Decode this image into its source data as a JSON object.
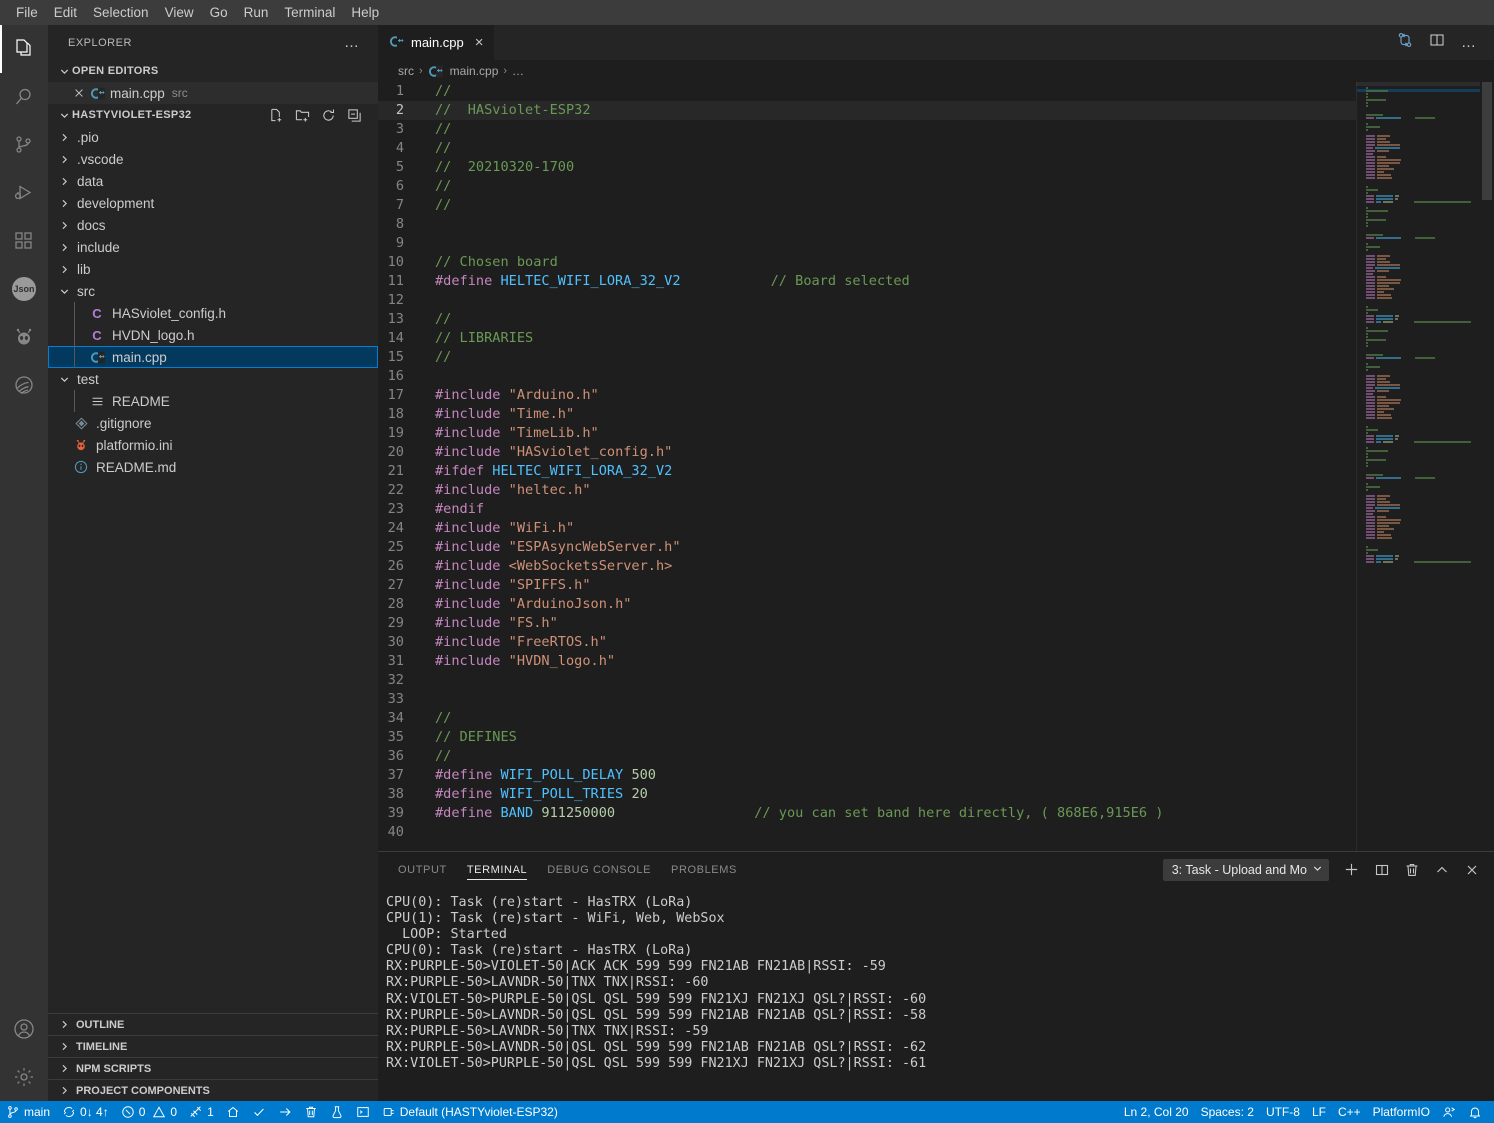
{
  "menubar": {
    "items": [
      "File",
      "Edit",
      "Selection",
      "View",
      "Go",
      "Run",
      "Terminal",
      "Help"
    ]
  },
  "activitybar": {
    "icons": [
      {
        "name": "explorer-icon",
        "active": true
      },
      {
        "name": "search-icon",
        "active": false
      },
      {
        "name": "source-control-icon",
        "active": false
      },
      {
        "name": "run-and-debug-icon",
        "active": false
      },
      {
        "name": "extensions-icon",
        "active": false
      },
      {
        "name": "json-icon",
        "label": "Json",
        "active": false
      },
      {
        "name": "platformio-alien-icon",
        "active": false
      },
      {
        "name": "remote-explorer-icon",
        "active": false
      }
    ],
    "bottom": [
      {
        "name": "accounts-icon"
      },
      {
        "name": "settings-gear-icon"
      }
    ]
  },
  "sidebar": {
    "title": "EXPLORER",
    "more_actions": "…",
    "open_editors": {
      "label": "OPEN EDITORS",
      "items": [
        {
          "name": "main.cpp",
          "folder": "src",
          "icon": "cpp-file-icon"
        }
      ]
    },
    "project": {
      "label": "HASTYVIOLET-ESP32",
      "actions": [
        "new-file-icon",
        "new-folder-icon",
        "refresh-icon",
        "collapse-all-icon"
      ],
      "tree": [
        {
          "label": ".pio",
          "type": "folder",
          "expanded": false,
          "indent": 1
        },
        {
          "label": ".vscode",
          "type": "folder",
          "expanded": false,
          "indent": 1
        },
        {
          "label": "data",
          "type": "folder",
          "expanded": false,
          "indent": 1
        },
        {
          "label": "development",
          "type": "folder",
          "expanded": false,
          "indent": 1
        },
        {
          "label": "docs",
          "type": "folder",
          "expanded": false,
          "indent": 1
        },
        {
          "label": "include",
          "type": "folder",
          "expanded": false,
          "indent": 1
        },
        {
          "label": "lib",
          "type": "folder",
          "expanded": false,
          "indent": 1
        },
        {
          "label": "src",
          "type": "folder",
          "expanded": true,
          "indent": 1
        },
        {
          "label": "HASviolet_config.h",
          "type": "header-file",
          "indent": 2
        },
        {
          "label": "HVDN_logo.h",
          "type": "header-file",
          "indent": 2
        },
        {
          "label": "main.cpp",
          "type": "cpp-file",
          "indent": 2,
          "selected": true
        },
        {
          "label": "test",
          "type": "folder",
          "expanded": true,
          "indent": 1
        },
        {
          "label": "README",
          "type": "readme-file",
          "indent": 2
        },
        {
          "label": ".gitignore",
          "type": "git-file",
          "indent": 1
        },
        {
          "label": "platformio.ini",
          "type": "platformio-file",
          "indent": 1
        },
        {
          "label": "README.md",
          "type": "markdown-file",
          "indent": 1
        }
      ]
    },
    "collapsed_sections": [
      "OUTLINE",
      "TIMELINE",
      "NPM SCRIPTS",
      "PROJECT COMPONENTS"
    ]
  },
  "editor": {
    "tabs": [
      {
        "label": "main.cpp",
        "icon": "cpp-file-icon",
        "active": true,
        "close": "×"
      }
    ],
    "tab_actions": [
      "split-editor-vertical-icon",
      "more-actions-icon"
    ],
    "breadcrumb": [
      "src",
      "main.cpp",
      "…"
    ],
    "breadcrumb_separator": "›",
    "lines": [
      {
        "n": 1,
        "tokens": [
          {
            "t": "//",
            "c": "c-comment"
          }
        ]
      },
      {
        "n": 2,
        "current": true,
        "tokens": [
          {
            "t": "//  HASviolet-ESP32",
            "c": "c-comment"
          }
        ]
      },
      {
        "n": 3,
        "tokens": [
          {
            "t": "//",
            "c": "c-comment"
          }
        ]
      },
      {
        "n": 4,
        "tokens": [
          {
            "t": "//",
            "c": "c-comment"
          }
        ]
      },
      {
        "n": 5,
        "tokens": [
          {
            "t": "//  20210320-1700",
            "c": "c-comment"
          }
        ]
      },
      {
        "n": 6,
        "tokens": [
          {
            "t": "//",
            "c": "c-comment"
          }
        ]
      },
      {
        "n": 7,
        "tokens": [
          {
            "t": "//",
            "c": "c-comment"
          }
        ]
      },
      {
        "n": 8,
        "tokens": []
      },
      {
        "n": 9,
        "tokens": []
      },
      {
        "n": 10,
        "tokens": [
          {
            "t": "// Chosen board",
            "c": "c-comment"
          }
        ]
      },
      {
        "n": 11,
        "tokens": [
          {
            "t": "#define ",
            "c": "c-pre"
          },
          {
            "t": "HELTEC_WIFI_LORA_32_V2",
            "c": "c-macro"
          },
          {
            "t": "           ",
            "c": "c-plain"
          },
          {
            "t": "// Board selected",
            "c": "c-comment"
          }
        ]
      },
      {
        "n": 12,
        "tokens": []
      },
      {
        "n": 13,
        "tokens": [
          {
            "t": "//",
            "c": "c-comment"
          }
        ]
      },
      {
        "n": 14,
        "tokens": [
          {
            "t": "// LIBRARIES",
            "c": "c-comment"
          }
        ]
      },
      {
        "n": 15,
        "tokens": [
          {
            "t": "//",
            "c": "c-comment"
          }
        ]
      },
      {
        "n": 16,
        "tokens": []
      },
      {
        "n": 17,
        "tokens": [
          {
            "t": "#include ",
            "c": "c-pre"
          },
          {
            "t": "\"Arduino.h\"",
            "c": "c-str"
          }
        ]
      },
      {
        "n": 18,
        "tokens": [
          {
            "t": "#include ",
            "c": "c-pre"
          },
          {
            "t": "\"Time.h\"",
            "c": "c-str"
          }
        ]
      },
      {
        "n": 19,
        "tokens": [
          {
            "t": "#include ",
            "c": "c-pre"
          },
          {
            "t": "\"TimeLib.h\"",
            "c": "c-str"
          }
        ]
      },
      {
        "n": 20,
        "tokens": [
          {
            "t": "#include ",
            "c": "c-pre"
          },
          {
            "t": "\"HASviolet_config.h\"",
            "c": "c-str"
          }
        ]
      },
      {
        "n": 21,
        "tokens": [
          {
            "t": "#ifdef ",
            "c": "c-pre"
          },
          {
            "t": "HELTEC_WIFI_LORA_32_V2",
            "c": "c-macro"
          }
        ]
      },
      {
        "n": 22,
        "tokens": [
          {
            "t": "#include ",
            "c": "c-pre"
          },
          {
            "t": "\"heltec.h\"",
            "c": "c-str"
          }
        ]
      },
      {
        "n": 23,
        "tokens": [
          {
            "t": "#endif",
            "c": "c-pre"
          }
        ]
      },
      {
        "n": 24,
        "tokens": [
          {
            "t": "#include ",
            "c": "c-pre"
          },
          {
            "t": "\"WiFi.h\"",
            "c": "c-str"
          }
        ]
      },
      {
        "n": 25,
        "tokens": [
          {
            "t": "#include ",
            "c": "c-pre"
          },
          {
            "t": "\"ESPAsyncWebServer.h\"",
            "c": "c-str"
          }
        ]
      },
      {
        "n": 26,
        "tokens": [
          {
            "t": "#include ",
            "c": "c-pre"
          },
          {
            "t": "<WebSocketsServer.h>",
            "c": "c-str"
          }
        ]
      },
      {
        "n": 27,
        "tokens": [
          {
            "t": "#include ",
            "c": "c-pre"
          },
          {
            "t": "\"SPIFFS.h\"",
            "c": "c-str"
          }
        ]
      },
      {
        "n": 28,
        "tokens": [
          {
            "t": "#include ",
            "c": "c-pre"
          },
          {
            "t": "\"ArduinoJson.h\"",
            "c": "c-str"
          }
        ]
      },
      {
        "n": 29,
        "tokens": [
          {
            "t": "#include ",
            "c": "c-pre"
          },
          {
            "t": "\"FS.h\"",
            "c": "c-str"
          }
        ]
      },
      {
        "n": 30,
        "tokens": [
          {
            "t": "#include ",
            "c": "c-pre"
          },
          {
            "t": "\"FreeRTOS.h\"",
            "c": "c-str"
          }
        ]
      },
      {
        "n": 31,
        "tokens": [
          {
            "t": "#include ",
            "c": "c-pre"
          },
          {
            "t": "\"HVDN_logo.h\"",
            "c": "c-str"
          }
        ]
      },
      {
        "n": 32,
        "tokens": []
      },
      {
        "n": 33,
        "tokens": []
      },
      {
        "n": 34,
        "tokens": [
          {
            "t": "//",
            "c": "c-comment"
          }
        ]
      },
      {
        "n": 35,
        "tokens": [
          {
            "t": "// DEFINES",
            "c": "c-comment"
          }
        ]
      },
      {
        "n": 36,
        "tokens": [
          {
            "t": "//",
            "c": "c-comment"
          }
        ]
      },
      {
        "n": 37,
        "tokens": [
          {
            "t": "#define ",
            "c": "c-pre"
          },
          {
            "t": "WIFI_POLL_DELAY ",
            "c": "c-macro"
          },
          {
            "t": "500",
            "c": "c-num"
          }
        ]
      },
      {
        "n": 38,
        "tokens": [
          {
            "t": "#define ",
            "c": "c-pre"
          },
          {
            "t": "WIFI_POLL_TRIES ",
            "c": "c-macro"
          },
          {
            "t": "20",
            "c": "c-num"
          }
        ]
      },
      {
        "n": 39,
        "tokens": [
          {
            "t": "#define ",
            "c": "c-pre"
          },
          {
            "t": "BAND ",
            "c": "c-macro"
          },
          {
            "t": "911250000",
            "c": "c-num"
          },
          {
            "t": "                 ",
            "c": "c-plain"
          },
          {
            "t": "// you can set band here directly, ( 868E6,915E6 )",
            "c": "c-comment"
          }
        ]
      },
      {
        "n": 40,
        "tokens": []
      }
    ]
  },
  "panel": {
    "tabs": [
      {
        "label": "OUTPUT",
        "active": false
      },
      {
        "label": "TERMINAL",
        "active": true
      },
      {
        "label": "DEBUG CONSOLE",
        "active": false
      },
      {
        "label": "PROBLEMS",
        "active": false
      }
    ],
    "terminal_selector": "3: Task - Upload and Mo",
    "actions": [
      "new-terminal-icon",
      "split-terminal-icon",
      "kill-terminal-icon",
      "maximize-panel-icon",
      "close-panel-icon"
    ],
    "terminal_output": [
      "CPU(0): Task (re)start - HasTRX (LoRa)",
      "CPU(1): Task (re)start - WiFi, Web, WebSox",
      "  LOOP: Started",
      "CPU(0): Task (re)start - HasTRX (LoRa)",
      "RX:PURPLE-50>VIOLET-50|ACK ACK 599 599 FN21AB FN21AB|RSSI: -59",
      "RX:PURPLE-50>LAVNDR-50|TNX TNX|RSSI: -60",
      "RX:VIOLET-50>PURPLE-50|QSL QSL 599 599 FN21XJ FN21XJ QSL?|RSSI: -60",
      "RX:PURPLE-50>LAVNDR-50|QSL QSL 599 599 FN21AB FN21AB QSL?|RSSI: -58",
      "RX:PURPLE-50>LAVNDR-50|TNX TNX|RSSI: -59",
      "RX:PURPLE-50>LAVNDR-50|QSL QSL 599 599 FN21AB FN21AB QSL?|RSSI: -62",
      "RX:VIOLET-50>PURPLE-50|QSL QSL 599 599 FN21XJ FN21XJ QSL?|RSSI: -61"
    ]
  },
  "statusbar": {
    "left": [
      {
        "name": "remote-branch",
        "icon": "source-control-branch-icon",
        "label": "main"
      },
      {
        "name": "sync-changes",
        "icon": "sync-icon",
        "label": "0↓ 4↑"
      },
      {
        "name": "problems",
        "icon": "error-warning-icon",
        "label": "0  0"
      },
      {
        "name": "ports",
        "icon": "ports-icon",
        "label": "1"
      },
      {
        "name": "pio-home",
        "icon": "home-icon",
        "label": ""
      },
      {
        "name": "pio-build",
        "icon": "check-icon",
        "label": ""
      },
      {
        "name": "pio-upload",
        "icon": "arrow-right-icon",
        "label": ""
      },
      {
        "name": "pio-clean",
        "icon": "trash-icon",
        "label": ""
      },
      {
        "name": "pio-test",
        "icon": "beaker-icon",
        "label": ""
      },
      {
        "name": "pio-terminal",
        "icon": "terminal-icon",
        "label": ""
      },
      {
        "name": "pio-project-env",
        "icon": "plug-icon",
        "label": "Default (HASTYviolet-ESP32)"
      }
    ],
    "right": [
      {
        "name": "cursor-position",
        "label": "Ln 2, Col 20"
      },
      {
        "name": "indentation",
        "label": "Spaces: 2"
      },
      {
        "name": "encoding",
        "label": "UTF-8"
      },
      {
        "name": "eol",
        "label": "LF"
      },
      {
        "name": "language-mode",
        "label": "C++"
      },
      {
        "name": "platformio-status",
        "label": "PlatformIO"
      },
      {
        "name": "live-share",
        "icon": "live-share-icon",
        "label": ""
      },
      {
        "name": "notifications",
        "icon": "bell-icon",
        "label": ""
      }
    ]
  },
  "colors": {
    "accent": "#007acc",
    "editor_bg": "#1e1e1e",
    "sidebar_bg": "#252526",
    "activitybar_bg": "#333333",
    "menubar_bg": "#3c3c3c",
    "selection_bg": "#04395e",
    "selection_border": "#007fd4",
    "comment": "#6a9955",
    "preprocessor": "#c586c0",
    "macro": "#4fc1ff",
    "string": "#ce9178",
    "number": "#b5cea8"
  }
}
